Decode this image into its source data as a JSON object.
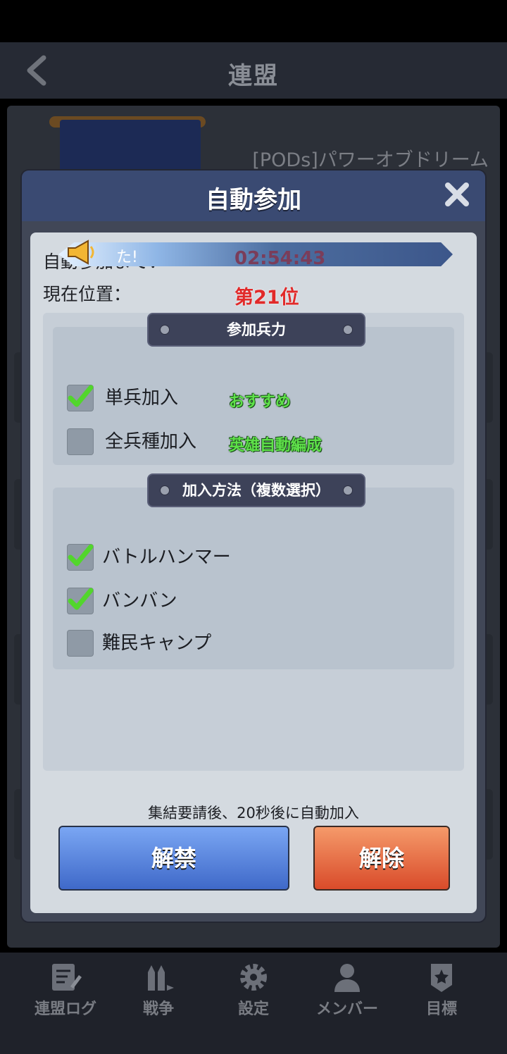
{
  "screen": {
    "title": "連盟",
    "alliance_name": "[PODs]パワーオブドリーム"
  },
  "dialog": {
    "title": "自動参加",
    "auto_join_label": "自動参加まで：",
    "ribbon_text": "た!",
    "timer": "02:54:43",
    "position_label": "現在位置：",
    "rank": "第21位",
    "troop_section": {
      "title": "参加兵力",
      "options": [
        {
          "label": "単兵加入",
          "checked": true,
          "tag": "おすすめ"
        },
        {
          "label": "全兵種加入",
          "checked": false,
          "tag": "英雄自動編成"
        }
      ]
    },
    "method_section": {
      "title": "加入方法（複数選択）",
      "options": [
        {
          "label": "バトルハンマー",
          "checked": true
        },
        {
          "label": "バンバン",
          "checked": true
        },
        {
          "label": "難民キャンプ",
          "checked": false
        }
      ]
    },
    "footnote": "集結要請後、20秒後に自動加入",
    "btn_unlock": "解禁",
    "btn_cancel": "解除"
  },
  "nav": [
    {
      "label": "連盟ログ",
      "icon": "log-icon"
    },
    {
      "label": "戦争",
      "icon": "war-icon"
    },
    {
      "label": "設定",
      "icon": "settings-icon"
    },
    {
      "label": "メンバー",
      "icon": "member-icon"
    },
    {
      "label": "目標",
      "icon": "goal-icon"
    }
  ],
  "colors": {
    "rank": "#e12a2a",
    "tag_green": "#5fe04a",
    "button_blue": "#4a74d0",
    "button_red": "#e25a34"
  }
}
